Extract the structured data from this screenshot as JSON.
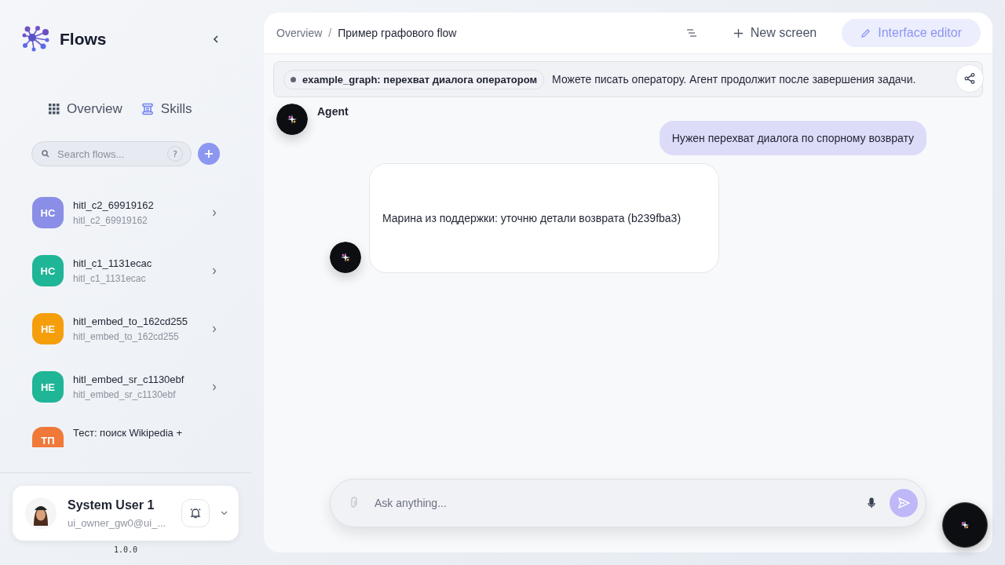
{
  "app": {
    "name": "Flows"
  },
  "nav": [
    {
      "label": "Overview",
      "kind": "grid"
    },
    {
      "label": "Skills",
      "kind": "scroll"
    }
  ],
  "search": {
    "placeholder": "Search flows...",
    "help": "?"
  },
  "flows": [
    {
      "initials": "HC",
      "title": "hitl_c2_69919162",
      "subtitle": "hitl_c2_69919162",
      "color": "#8a8ee6"
    },
    {
      "initials": "HC",
      "title": "hitl_c1_1131ecac",
      "subtitle": "hitl_c1_1131ecac",
      "color": "#1fb597"
    },
    {
      "initials": "HE",
      "title": "hitl_embed_to_162cd255",
      "subtitle": "hitl_embed_to_162cd255",
      "color": "#f59e0b"
    },
    {
      "initials": "HE",
      "title": "hitl_embed_sr_c1130ebf",
      "subtitle": "hitl_embed_sr_c1130ebf",
      "color": "#1fb597"
    },
    {
      "initials": "ТП",
      "title": "Тест: поиск Wikipedia +",
      "color": "#f0793a"
    }
  ],
  "user": {
    "name": "System User 1",
    "email": "ui_owner_gw0@ui_..."
  },
  "version": "1.0.0",
  "breadcrumb": [
    "Overview",
    "Пример графового flow"
  ],
  "breadcrumb_separator": "/",
  "toolbar": {
    "new_screen": "New screen",
    "editor": "Interface editor"
  },
  "banner": {
    "tag": "example_graph: перехват диалога оператором",
    "text": "Можете писать оператору. Агент продолжит после завершения задачи."
  },
  "agent": {
    "name": "Agent"
  },
  "messages": [
    {
      "kind": "user",
      "text": "Нужен перехват диалога по спорному возврату"
    },
    {
      "kind": "operator",
      "text": "Марина из поддержки: уточню детали возврата (b239fba3)"
    }
  ],
  "composer": {
    "placeholder": "Ask anything..."
  }
}
